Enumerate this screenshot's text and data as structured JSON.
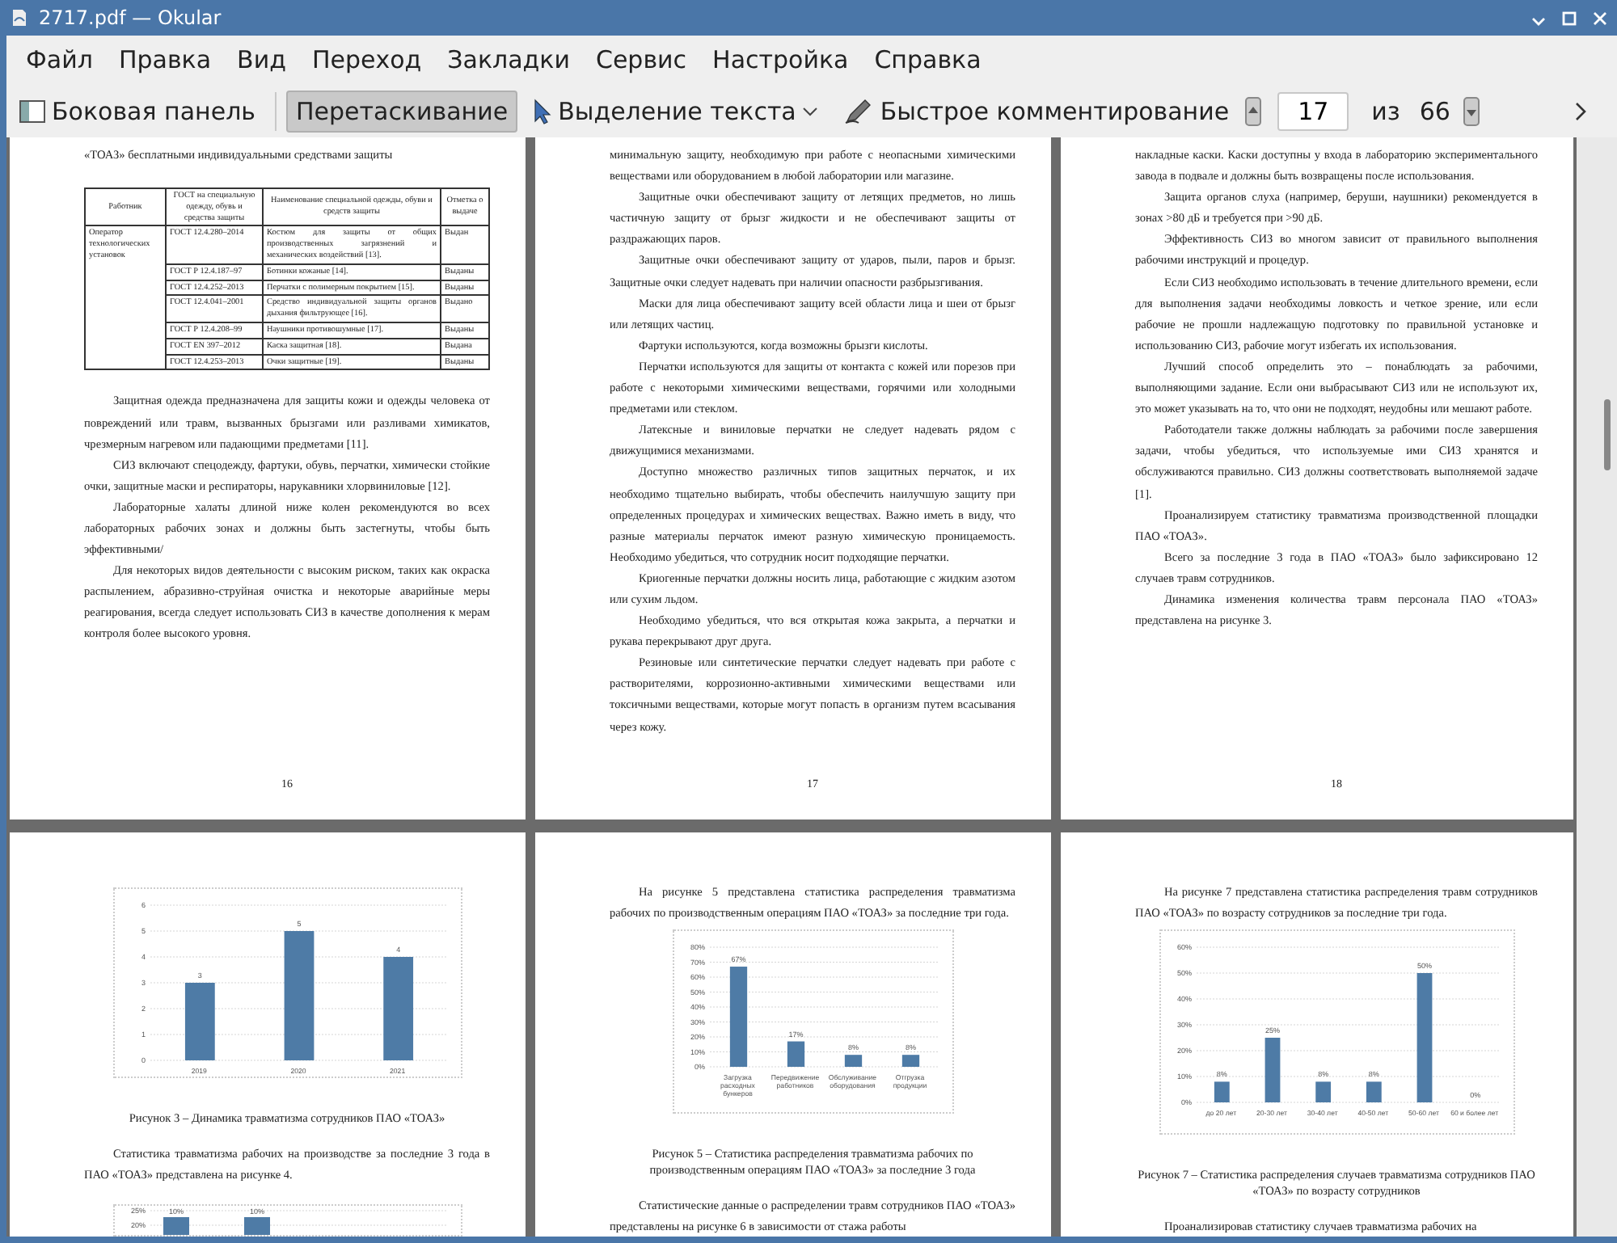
{
  "window": {
    "title": "2717.pdf — Okular"
  },
  "menu": [
    "Файл",
    "Правка",
    "Вид",
    "Переход",
    "Закладки",
    "Сервис",
    "Настройка",
    "Справка"
  ],
  "toolbar": {
    "items": [
      {
        "kind": "sidebar",
        "label": "Боковая панель",
        "selected": false
      },
      {
        "kind": "browse",
        "label": "Перетаскивание",
        "selected": true
      },
      {
        "kind": "select",
        "label": "Выделение текста",
        "selected": false
      },
      {
        "kind": "annotate",
        "label": "Быстрое комментирование",
        "selected": false
      }
    ],
    "page_field": {
      "value": "17"
    },
    "of_label": "из",
    "page_count": "66"
  },
  "pages": [
    {
      "number": "16",
      "blocks": [
        {
          "kind": "continuation",
          "text": "«ТОАЗ» бесплатными индивидуальными средствами защиты"
        },
        {
          "kind": "table",
          "columns": [
            "Работник",
            "ГОСТ на специальную одежду, обувь и средства защиты",
            "Наименование специальной одежды, обуви и средств защиты",
            "Отметка о выдаче"
          ],
          "worker": "Оператор технологических установок",
          "rows": [
            {
              "standard": "ГОСТ 12.4.280–2014",
              "item": "Костюм для защиты от общих производственных загрязнений и механических воздействий [13].",
              "status": "Выдан"
            },
            {
              "standard": "ГОСТ Р 12.4.187–97",
              "item": "Ботинки кожаные [14].",
              "status": "Выданы"
            },
            {
              "standard": "ГОСТ 12.4.252–2013",
              "item": "Перчатки с полимерным покрытием [15].",
              "status": "Выданы"
            },
            {
              "standard": "ГОСТ 12.4.041–2001",
              "item": "Средство индивидуальной защиты органов дыхания фильтрующее [16].",
              "status": "Выдано"
            },
            {
              "standard": "ГОСТ Р 12.4.208–99",
              "item": "Наушники противошумные [17].",
              "status": "Выданы"
            },
            {
              "standard": "ГОСТ EN 397–2012",
              "item": "Каска защитная [18].",
              "status": "Выдана"
            },
            {
              "standard": "ГОСТ 12.4.253–2013",
              "item": "Очки защитные [19].",
              "status": "Выданы"
            }
          ]
        },
        {
          "kind": "paragraph",
          "text": "Защитная одежда предназначена для защиты кожи и одежды человека от повреждений или травм, вызванных брызгами или разливами химикатов, чрезмерным нагревом или падающими предметами [11]."
        },
        {
          "kind": "paragraph",
          "text": "СИЗ включают спецодежду, фартуки, обувь, перчатки, химически стойкие очки, защитные маски и респираторы, нарукавники хлорвиниловые [12]."
        },
        {
          "kind": "paragraph",
          "text": "Лабораторные халаты длиной ниже колен рекомендуются во всех лабораторных рабочих зонах и должны быть застегнуты, чтобы быть эффективными/"
        },
        {
          "kind": "paragraph",
          "text": "Для некоторых видов деятельности с высоким риском, таких как окраска распылением, абразивно-струйная очистка и некоторые аварийные меры реагирования, всегда следует использовать СИЗ в качестве дополнения к мерам контроля более высокого уровня."
        }
      ]
    },
    {
      "number": "17",
      "blocks": [
        {
          "kind": "continuation",
          "text": "минимальную защиту, необходимую при работе с неопасными химическими веществами или оборудованием в любой лаборатории или магазине."
        },
        {
          "kind": "paragraph",
          "text": "Защитные очки обеспечивают защиту от летящих предметов, но лишь частичную защиту от брызг жидкости и не обеспечивают защиты от раздражающих паров."
        },
        {
          "kind": "paragraph",
          "text": "Защитные очки обеспечивают защиту от ударов, пыли, паров и брызг. Защитные очки следует надевать при наличии опасности разбрызгивания."
        },
        {
          "kind": "paragraph",
          "text": "Маски для лица обеспечивают защиту всей области лица и шеи от брызг или летящих частиц."
        },
        {
          "kind": "paragraph",
          "text": "Фартуки используются, когда возможны брызги кислоты."
        },
        {
          "kind": "paragraph",
          "text": "Перчатки используются для защиты от контакта с кожей или порезов при работе с некоторыми химическими веществами, горячими или холодными предметами или стеклом."
        },
        {
          "kind": "paragraph",
          "text": "Латексные и виниловые перчатки не следует надевать рядом с движущимися механизмами."
        },
        {
          "kind": "paragraph",
          "text": "Доступно множество различных типов защитных перчаток, и их необходимо тщательно выбирать, чтобы обеспечить наилучшую защиту при определенных процедурах и химических веществах. Важно иметь в виду, что разные материалы перчаток имеют разную химическую проницаемость. Необходимо убедиться, что сотрудник носит подходящие перчатки."
        },
        {
          "kind": "paragraph",
          "text": "Криогенные перчатки должны носить лица, работающие с жидким азотом или сухим льдом."
        },
        {
          "kind": "paragraph",
          "text": "Необходимо убедиться, что вся открытая кожа закрыта, а перчатки и рукава перекрывают друг друга."
        },
        {
          "kind": "paragraph",
          "text": "Резиновые или синтетические перчатки следует надевать при работе с растворителями, коррозионно-активными химическими веществами или токсичными веществами, которые могут попасть в организм путем всасывания через кожу."
        }
      ]
    },
    {
      "number": "18",
      "blocks": [
        {
          "kind": "continuation",
          "text": "накладные каски. Каски доступны у входа в лабораторию экспериментального завода в подвале и должны быть возвращены после использования."
        },
        {
          "kind": "paragraph",
          "text": "Защита органов слуха (например, беруши, наушники) рекомендуется в зонах >80 дБ и требуется при >90 дБ."
        },
        {
          "kind": "paragraph",
          "text": "Эффективность СИЗ во многом зависит от правильного выполнения рабочими инструкций и процедур."
        },
        {
          "kind": "paragraph",
          "text": "Если СИЗ необходимо использовать в течение длительного времени, если для выполнения задачи необходимы ловкость и четкое зрение, или если рабочие не прошли надлежащую подготовку по правильной установке и использованию СИЗ, рабочие могут избегать их использования."
        },
        {
          "kind": "paragraph",
          "text": "Лучший способ определить это – понаблюдать за рабочими, выполняющими задание. Если они выбрасывают СИЗ или не используют их, это может указывать на то, что они не подходят, неудобны или мешают работе."
        },
        {
          "kind": "paragraph",
          "text": "Работодатели также должны наблюдать за рабочими после завершения задачи, чтобы убедиться, что используемые ими СИЗ хранятся и обслуживаются правильно. СИЗ должны соответствовать выполняемой задаче [1]."
        },
        {
          "kind": "paragraph",
          "text": "Проанализируем статистику травматизма производственной площадки ПАО «ТОАЗ»."
        },
        {
          "kind": "paragraph",
          "text": "Всего за последние 3 года в ПАО «ТОАЗ» было зафиксировано 12 случаев травм сотрудников."
        },
        {
          "kind": "paragraph",
          "text": "Динамика изменения количества травм персонала ПАО «ТОАЗ» представлена на рисунке 3."
        }
      ]
    },
    {
      "blocks": [
        {
          "kind": "chart",
          "chart_data": {
            "type": "bar",
            "categories": [
              "2019",
              "2020",
              "2021"
            ],
            "series": [
              {
                "color": "#4e7ba6",
                "values": [
                  3,
                  5,
                  4
                ]
              }
            ],
            "grid": true,
            "ylim": [
              0,
              6
            ],
            "yticks": [
              0,
              1,
              2,
              3,
              4,
              5,
              6
            ],
            "data_labels": true
          }
        },
        {
          "kind": "caption",
          "text": "Рисунок 3 – Динамика травматизма сотрудников ПАО «ТОАЗ»"
        },
        {
          "kind": "paragraph",
          "text": "Статистика травматизма рабочих на производстве за последние 3 года в ПАО «ТОАЗ» представлена на рисунке 4."
        },
        {
          "kind": "partial_chart",
          "ticks": [
            "25%",
            "20%"
          ],
          "bar_labels": [
            "10%",
            "10%"
          ]
        }
      ]
    },
    {
      "blocks": [
        {
          "kind": "paragraph",
          "text": "На рисунке 5 представлена статистика распределения травматизма рабочих по производственным операциям ПАО «ТОАЗ» за последние три года."
        },
        {
          "kind": "chart",
          "chart_data": {
            "type": "bar",
            "categories": [
              "Загрузка расходных бункеров",
              "Передвижение работников",
              "Обслуживание оборудования",
              "Отгрузка продукции"
            ],
            "series": [
              {
                "color": "#4e7ba6",
                "values": [
                  67,
                  17,
                  8,
                  8
                ]
              }
            ],
            "grid": true,
            "ylim": [
              0,
              80
            ],
            "yticks": [
              {
                "value": 0,
                "label": "0%"
              },
              {
                "value": 10,
                "label": "10%"
              },
              {
                "value": 20,
                "label": "20%"
              },
              {
                "value": 30,
                "label": "30%"
              },
              {
                "value": 40,
                "label": "40%"
              },
              {
                "value": 50,
                "label": "50%"
              },
              {
                "value": 60,
                "label": "60%"
              },
              {
                "value": 70,
                "label": "70%"
              },
              {
                "value": 80,
                "label": "80%"
              }
            ],
            "value_labels": [
              "67%",
              "17%",
              "8%",
              "8%"
            ]
          }
        },
        {
          "kind": "caption",
          "text": "Рисунок 5 – Статистика распределения травматизма рабочих по производственным операциям ПАО «ТОАЗ» за последние 3 года"
        },
        {
          "kind": "paragraph",
          "text": "Статистические данные о распределении травм сотрудников ПАО «ТОАЗ» представлены на рисунке 6 в зависимости от стажа работы"
        }
      ]
    },
    {
      "blocks": [
        {
          "kind": "paragraph",
          "text": "На рисунке 7 представлена статистика распределения травм сотрудников ПАО «ТОАЗ» по возрасту сотрудников за последние три года."
        },
        {
          "kind": "chart",
          "chart_data": {
            "type": "bar",
            "categories": [
              "до 20 лет",
              "20-30 лет",
              "30-40 лет",
              "40-50 лет",
              "50-60 лет",
              "60 и более лет"
            ],
            "series": [
              {
                "color": "#4e7ba6",
                "values": [
                  8,
                  25,
                  8,
                  8,
                  50,
                  0
                ]
              }
            ],
            "grid": true,
            "ylim": [
              0,
              60
            ],
            "yticks": [
              {
                "value": 0,
                "label": "0%"
              },
              {
                "value": 10,
                "label": "10%"
              },
              {
                "value": 20,
                "label": "20%"
              },
              {
                "value": 30,
                "label": "30%"
              },
              {
                "value": 40,
                "label": "40%"
              },
              {
                "value": 50,
                "label": "50%"
              },
              {
                "value": 60,
                "label": "60%"
              }
            ],
            "value_labels": [
              "8%",
              "25%",
              "8%",
              "8%",
              "50%",
              "0%"
            ]
          }
        },
        {
          "kind": "caption",
          "text": "Рисунок 7 – Статистика распределения случаев травматизма сотрудников ПАО «ТОАЗ» по возрасту сотрудников"
        },
        {
          "kind": "paragraph",
          "text": "Проанализировав статистику случаев травматизма рабочих на"
        }
      ]
    }
  ]
}
